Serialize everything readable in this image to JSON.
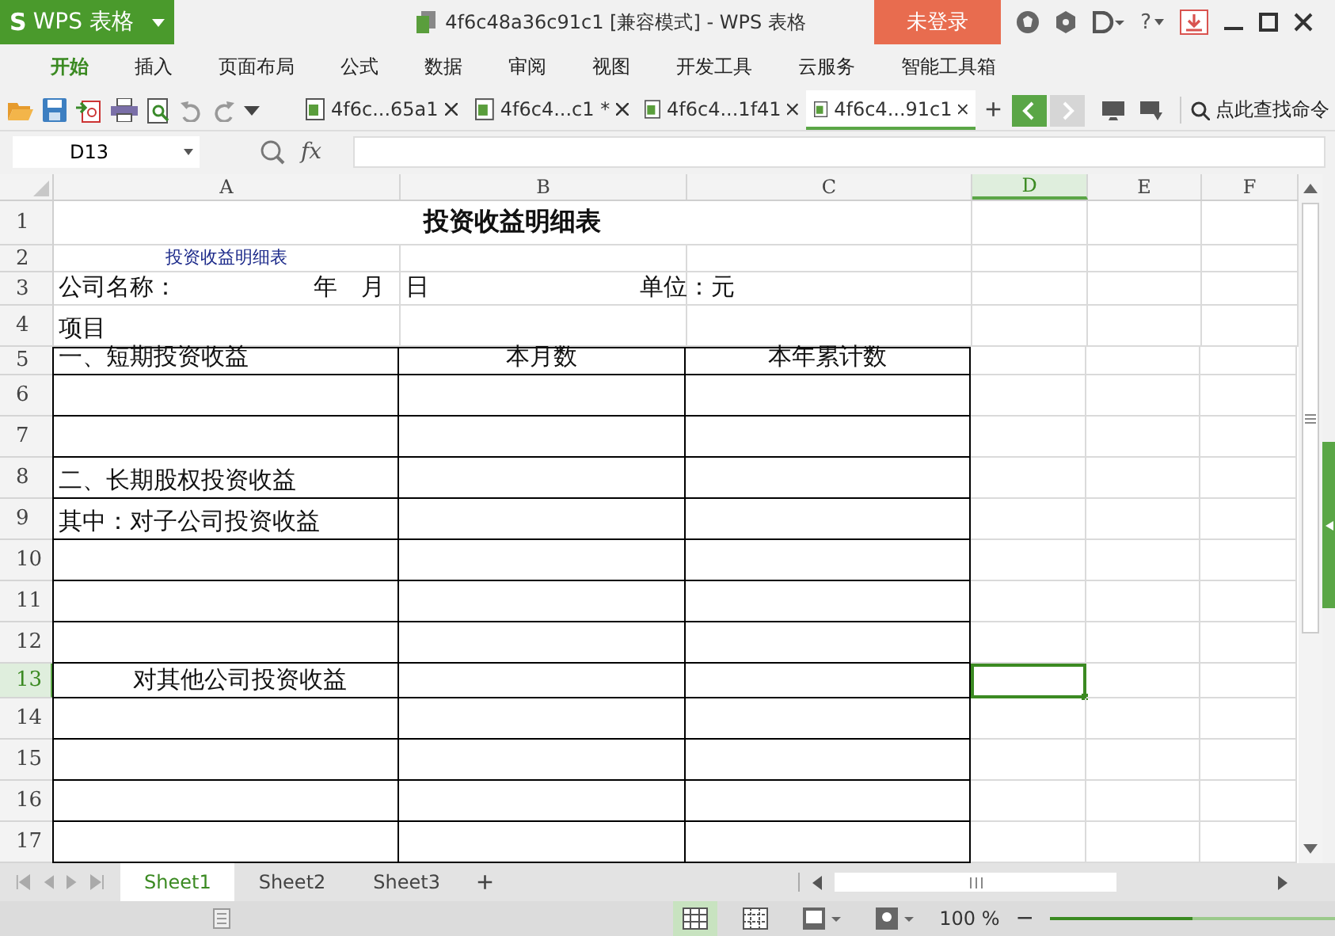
{
  "app_logo": "S",
  "app_button": "WPS 表格",
  "title": "4f6c48a36c91c1 [兼容模式] - WPS 表格",
  "login_button": "未登录",
  "help_label": "?",
  "menu": [
    {
      "label": "开始",
      "selected": true
    },
    {
      "label": "插入",
      "selected": false
    },
    {
      "label": "页面布局",
      "selected": false
    },
    {
      "label": "公式",
      "selected": false
    },
    {
      "label": "数据",
      "selected": false
    },
    {
      "label": "审阅",
      "selected": false
    },
    {
      "label": "视图",
      "selected": false
    },
    {
      "label": "开发工具",
      "selected": false
    },
    {
      "label": "云服务",
      "selected": false
    },
    {
      "label": "智能工具箱",
      "selected": false
    }
  ],
  "doc_tabs": [
    {
      "label": "4f6c...65a1",
      "selected": false
    },
    {
      "label": "4f6c4...c1 *",
      "selected": false
    },
    {
      "label": "4f6c4...1f41",
      "selected": false
    },
    {
      "label": "4f6c4...91c1",
      "selected": true
    }
  ],
  "command_search": "点此查找命令",
  "name_box": "D13",
  "fx": "fx",
  "columns": [
    {
      "label": "A",
      "selected": false
    },
    {
      "label": "B",
      "selected": false
    },
    {
      "label": "C",
      "selected": false
    },
    {
      "label": "D",
      "selected": true
    },
    {
      "label": "E",
      "selected": false
    },
    {
      "label": "F",
      "selected": false
    }
  ],
  "rows": [
    {
      "label": "1",
      "selected": false,
      "bordered": false,
      "cells": {
        "a": {
          "text": "投资收益明细表",
          "kind": "title",
          "merged": true
        }
      }
    },
    {
      "label": "2",
      "selected": false,
      "bordered": false,
      "cells": {
        "a": {
          "text": "投资收益明细表",
          "kind": "note"
        }
      }
    },
    {
      "label": "3",
      "selected": false,
      "bordered": false,
      "cells": {
        "a": {
          "text": "公司名称：",
          "trail": "年　月"
        },
        "b": {
          "text": "日",
          "trail": "单位：元"
        }
      }
    },
    {
      "label": "4",
      "selected": false,
      "bordered": false,
      "cells": {
        "a": {
          "text": "项目"
        }
      }
    },
    {
      "label": "5",
      "selected": false,
      "bordered": true,
      "cells": {
        "a": {
          "text": "一、短期投资收益"
        },
        "b": {
          "text": "本月数",
          "kind": "heading"
        },
        "c": {
          "text": "本年累计数",
          "kind": "heading"
        }
      }
    },
    {
      "label": "6",
      "selected": false,
      "bordered": true,
      "cells": {}
    },
    {
      "label": "7",
      "selected": false,
      "bordered": true,
      "cells": {}
    },
    {
      "label": "8",
      "selected": false,
      "bordered": true,
      "cells": {
        "a": {
          "text": "二、长期股权投资收益"
        }
      }
    },
    {
      "label": "9",
      "selected": false,
      "bordered": true,
      "cells": {
        "a": {
          "text": "其中：对子公司投资收益"
        }
      }
    },
    {
      "label": "10",
      "selected": false,
      "bordered": true,
      "cells": {}
    },
    {
      "label": "11",
      "selected": false,
      "bordered": true,
      "cells": {}
    },
    {
      "label": "12",
      "selected": false,
      "bordered": true,
      "cells": {}
    },
    {
      "label": "13",
      "selected": true,
      "bordered": true,
      "cells": {
        "a": {
          "text": "对其他公司投资收益",
          "kind": "indent"
        },
        "d": {
          "selected": true
        }
      }
    },
    {
      "label": "14",
      "selected": false,
      "bordered": true,
      "cells": {}
    },
    {
      "label": "15",
      "selected": false,
      "bordered": true,
      "cells": {}
    },
    {
      "label": "16",
      "selected": false,
      "bordered": true,
      "cells": {}
    },
    {
      "label": "17",
      "selected": false,
      "bordered": true,
      "cells": {}
    }
  ],
  "sheets": [
    {
      "label": "Sheet1",
      "selected": true
    },
    {
      "label": "Sheet2",
      "selected": false
    },
    {
      "label": "Sheet3",
      "selected": false
    }
  ],
  "add_sheet": "+",
  "new_tab": "+",
  "zoom": "100 %",
  "zoom_out": "−",
  "zoom_slider": {
    "level": 0.5
  }
}
